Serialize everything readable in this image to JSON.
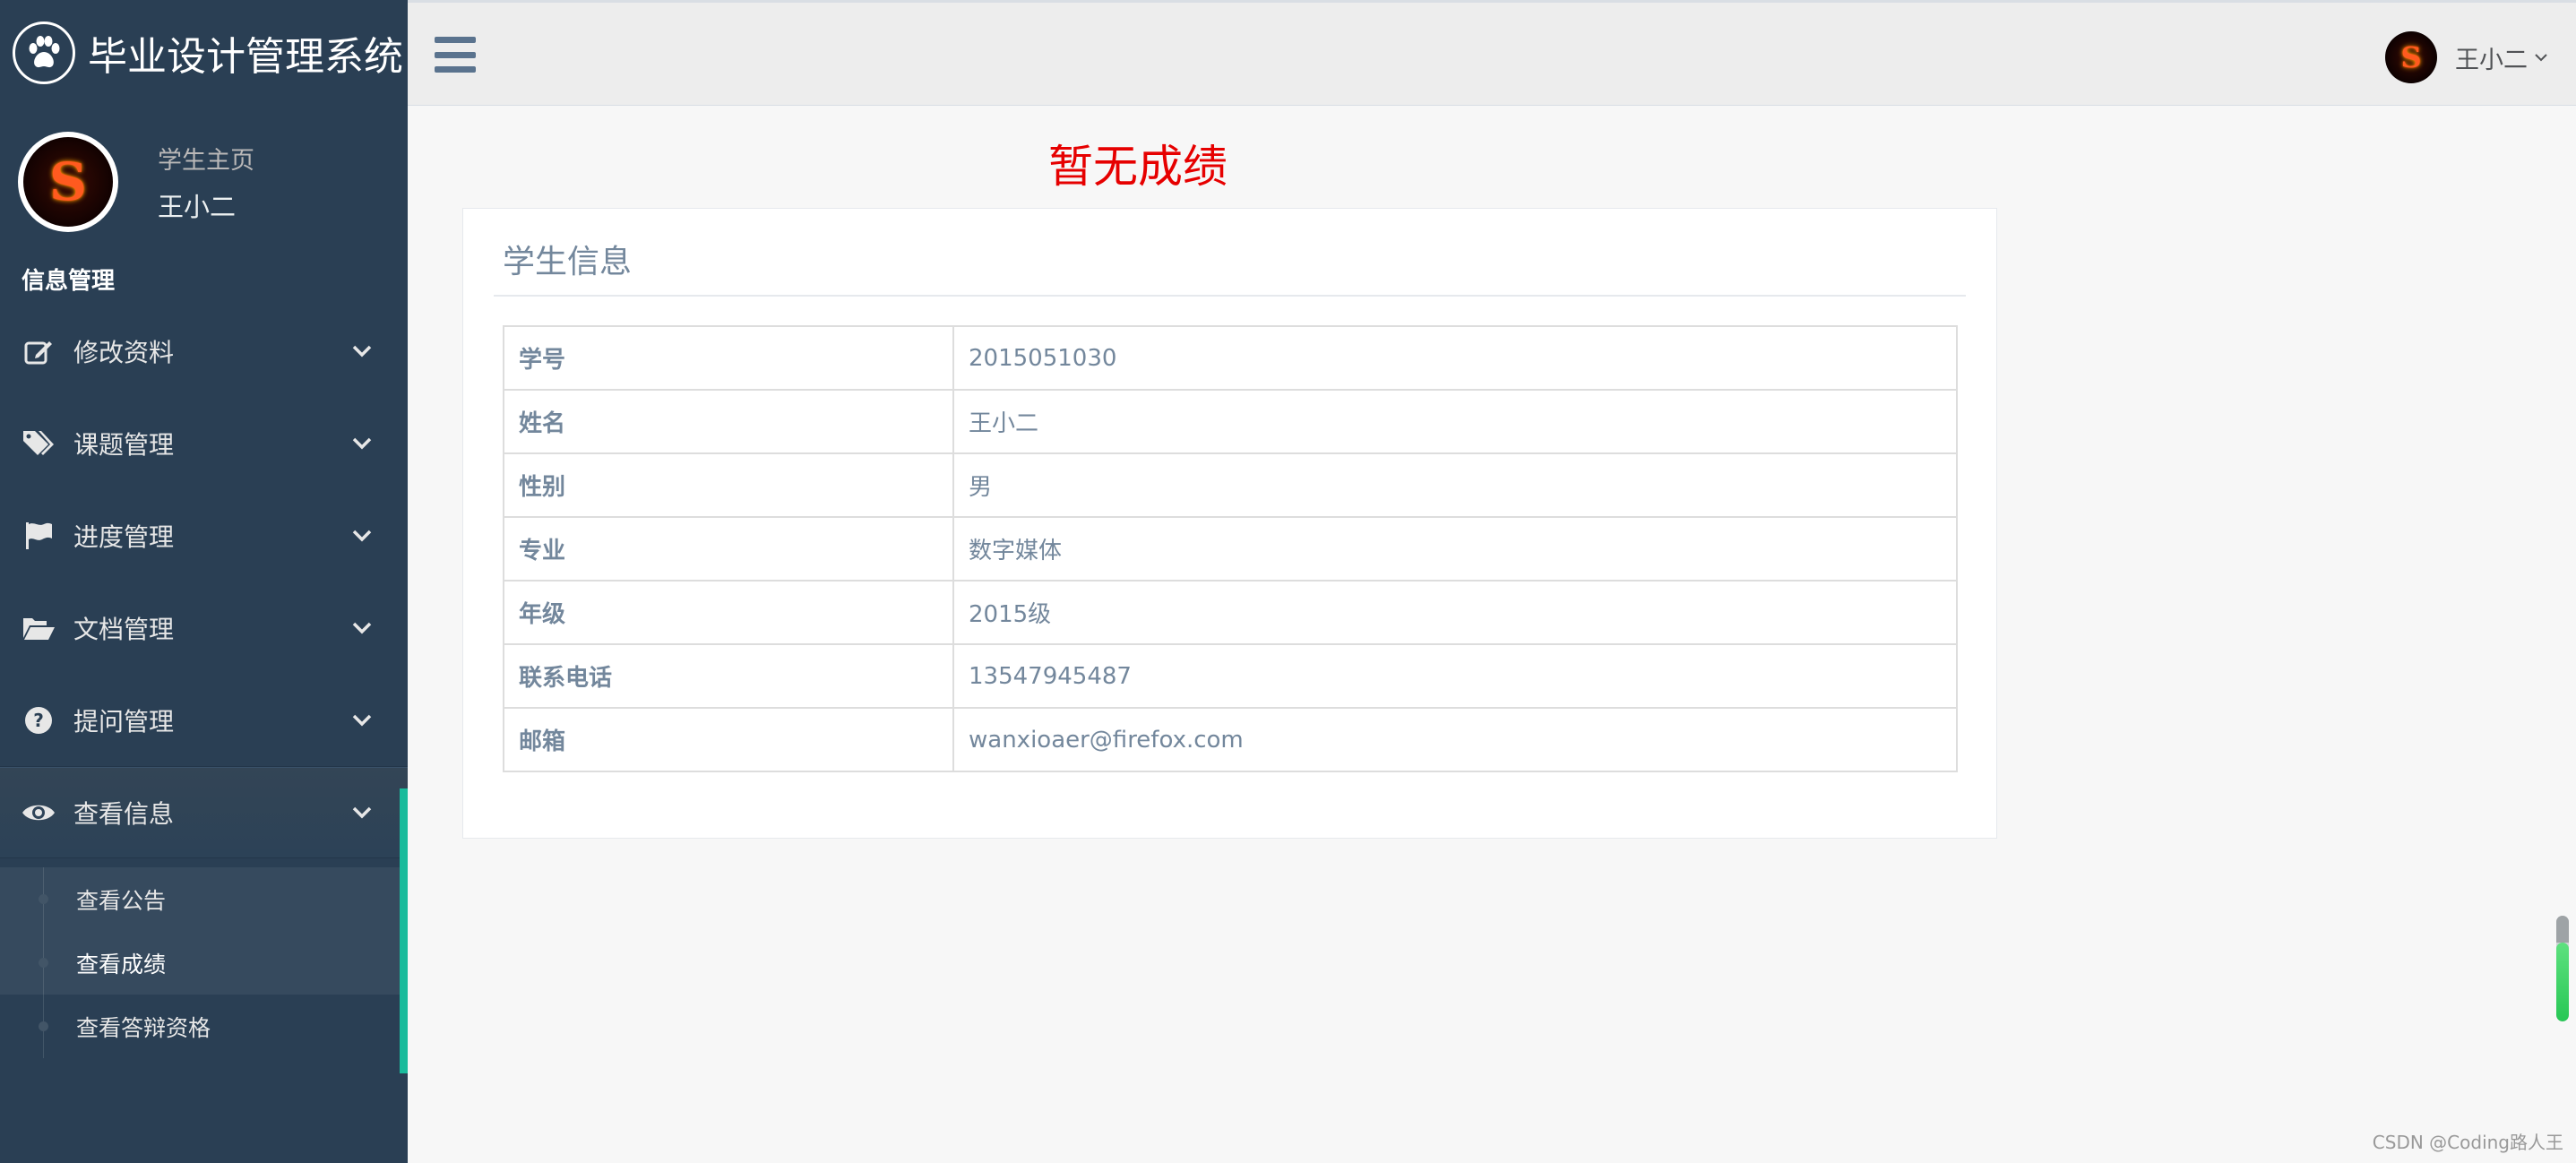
{
  "sidebar": {
    "brand_title": "毕业设计管理系统",
    "profile": {
      "subtitle": "学生主页",
      "name": "王小二"
    },
    "section_title": "信息管理",
    "items": [
      {
        "label": "修改资料",
        "icon": "edit-icon"
      },
      {
        "label": "课题管理",
        "icon": "tags-icon"
      },
      {
        "label": "进度管理",
        "icon": "flag-icon"
      },
      {
        "label": "文档管理",
        "icon": "folder-open-icon"
      },
      {
        "label": "提问管理",
        "icon": "question-circle-icon"
      },
      {
        "label": "查看信息",
        "icon": "eye-icon",
        "active": true
      }
    ],
    "subitems": [
      {
        "label": "查看公告"
      },
      {
        "label": "查看成绩",
        "current": true
      },
      {
        "label": "查看答辩资格"
      }
    ]
  },
  "topnav": {
    "user_name": "王小二"
  },
  "main": {
    "no_score": "暂无成绩",
    "panel_title": "学生信息",
    "rows": [
      {
        "key": "学号",
        "value": "2015051030"
      },
      {
        "key": "姓名",
        "value": "王小二"
      },
      {
        "key": "性别",
        "value": "男"
      },
      {
        "key": "专业",
        "value": "数字媒体"
      },
      {
        "key": "年级",
        "value": "2015级"
      },
      {
        "key": "联系电话",
        "value": "13547945487"
      },
      {
        "key": "邮箱",
        "value": "wanxioaer@firefox.com"
      }
    ]
  },
  "watermark": "CSDN @Coding路人王",
  "colors": {
    "sidebar_bg": "#2a3f54",
    "accent": "#1abb9c",
    "alert": "#e60000"
  }
}
